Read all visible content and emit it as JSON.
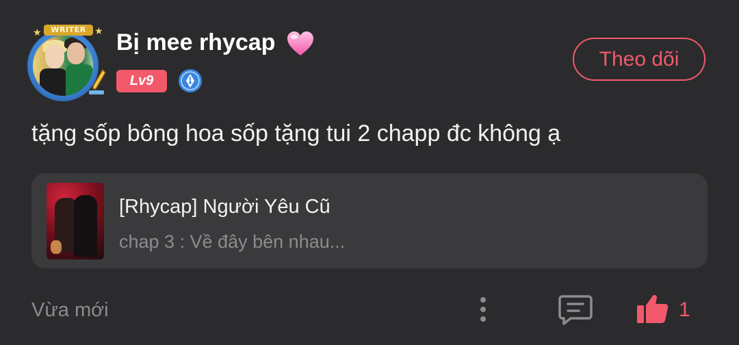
{
  "user": {
    "name": "Bị mee rhycap",
    "avatar_badge": "WRITER",
    "level": "Lv9"
  },
  "follow_button": {
    "label": "Theo dõi"
  },
  "comment": {
    "text": "tặng sốp bông hoa sốp tặng tui 2 chapp đc không ạ"
  },
  "story": {
    "title": "[Rhycap] Người Yêu Cũ",
    "chapter": "chap 3 : Về đây bên nhau..."
  },
  "footer": {
    "timestamp": "Vừa mới",
    "like_count": "1"
  },
  "icons": {
    "more": "more-vertical-icon",
    "comment": "comment-icon",
    "like": "thumbs-up-icon",
    "heart": "pink-heart-icon",
    "writer": "pen-nib-icon"
  },
  "colors": {
    "background": "#2b2b2d",
    "card": "#3a3a3c",
    "accent": "#f25a6b",
    "muted_text": "#8c8c8e",
    "writer_badge": "#3a86e0"
  }
}
